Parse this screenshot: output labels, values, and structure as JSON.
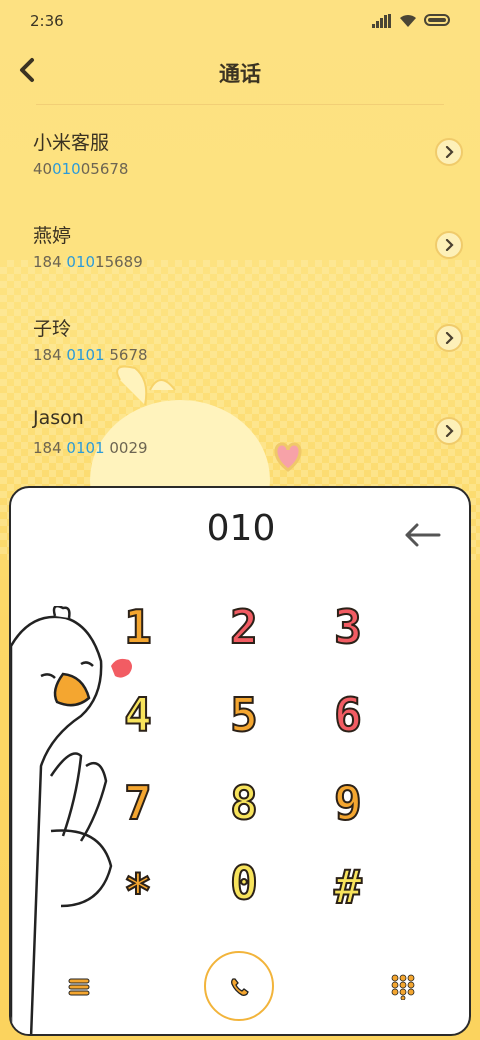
{
  "status": {
    "time": "2:36"
  },
  "header": {
    "title": "通话"
  },
  "contacts": [
    {
      "name": "小米客服",
      "num_pre": "40",
      "num_hl": "010",
      "num_post": "05678"
    },
    {
      "name": "燕婷",
      "num_pre": "184 ",
      "num_hl": "010",
      "num_post": "15689"
    },
    {
      "name": "子玲",
      "num_pre": "184 ",
      "num_hl": "0101",
      "num_post": " 5678"
    },
    {
      "name": "Jason",
      "num_pre": "184 ",
      "num_hl": "0101",
      "num_post": " 0029"
    }
  ],
  "dialer": {
    "typed": "010",
    "keys": [
      "1",
      "2",
      "3",
      "4",
      "5",
      "6",
      "7",
      "8",
      "9",
      "*",
      "0",
      "#"
    ],
    "key_colors": [
      "#f4a630",
      "#f25c63",
      "#f25c63",
      "#f7e35c",
      "#f4a630",
      "#f25c63",
      "#f4a630",
      "#f7e35c",
      "#f4a630",
      "#f4a630",
      "#f7e35c",
      "#f7e35c"
    ]
  },
  "icons": {
    "back": "chevron-left-icon",
    "chevron": "chevron-right-icon",
    "backspace": "backspace-arrow-icon",
    "menu": "menu-icon",
    "call": "phone-icon",
    "keypad": "keypad-grid-icon"
  },
  "colors": {
    "highlight": "#2d9bd8",
    "accent": "#f2b43b",
    "background": "#fde182"
  }
}
